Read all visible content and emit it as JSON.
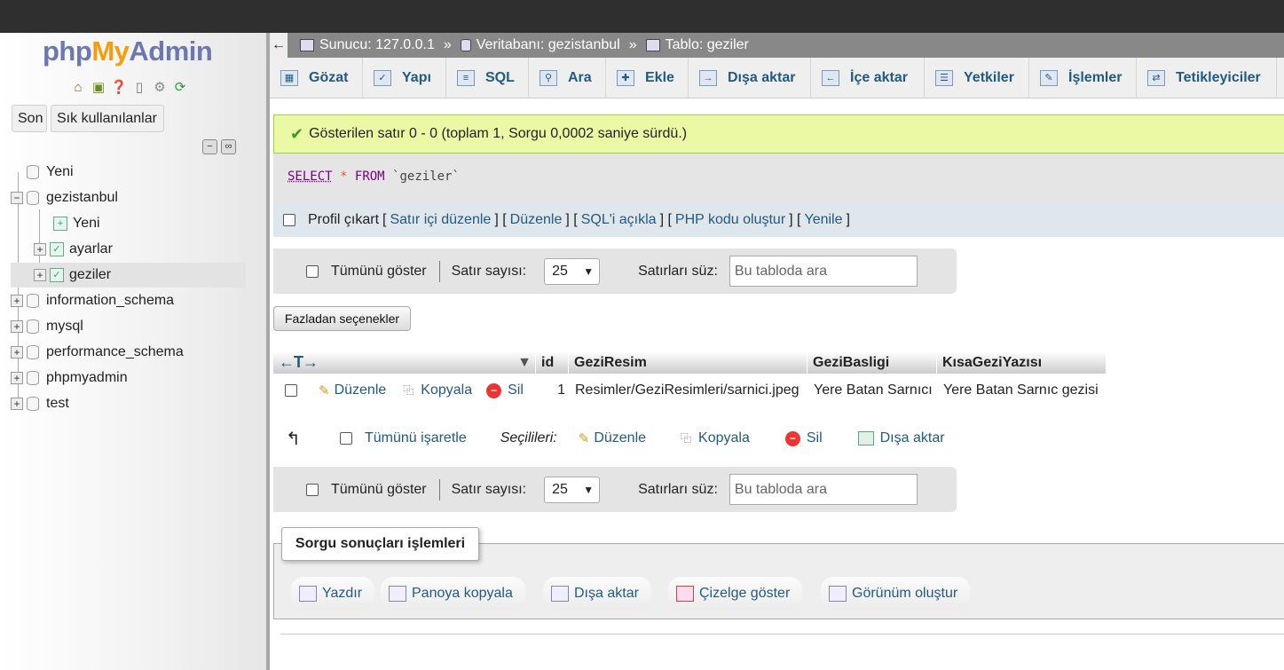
{
  "logo": {
    "php": "php",
    "my": "My",
    "admin": "Admin"
  },
  "sidebar": {
    "recent_button": "Son",
    "favorites_button": "Sık kullanılanlar",
    "tree": [
      {
        "label": "Yeni",
        "level": 0,
        "kind": "new"
      },
      {
        "label": "gezistanbul",
        "level": 0,
        "kind": "db-open"
      },
      {
        "label": "Yeni",
        "level": 1,
        "kind": "new"
      },
      {
        "label": "ayarlar",
        "level": 1,
        "kind": "table"
      },
      {
        "label": "geziler",
        "level": 1,
        "kind": "table"
      },
      {
        "label": "information_schema",
        "level": 0,
        "kind": "db"
      },
      {
        "label": "mysql",
        "level": 0,
        "kind": "db"
      },
      {
        "label": "performance_schema",
        "level": 0,
        "kind": "db"
      },
      {
        "label": "phpmyadmin",
        "level": 0,
        "kind": "db"
      },
      {
        "label": "test",
        "level": 0,
        "kind": "db"
      }
    ]
  },
  "breadcrumb": {
    "server": "Sunucu: 127.0.0.1",
    "database": "Veritabanı: gezistanbul",
    "table": "Tablo: geziler",
    "separator": "»"
  },
  "tabs": [
    "Gözat",
    "Yapı",
    "SQL",
    "Ara",
    "Ekle",
    "Dışa aktar",
    "İçe aktar",
    "Yetkiler",
    "İşlemler",
    "Tetikleyiciler"
  ],
  "message": {
    "success": "Gösterilen satır 0 - 0 (toplam 1, Sorgu 0,0002 saniye sürdü.)"
  },
  "query": {
    "select": "SELECT",
    "star": "*",
    "from": "FROM",
    "table": "`geziler`"
  },
  "profile": {
    "label": "Profil çıkart",
    "links": [
      "Satır içi düzenle",
      "Düzenle",
      "SQL'i açıkla",
      "PHP kodu oluştur",
      "Yenile"
    ]
  },
  "navigation": {
    "show_all": "Tümünü göster",
    "rows_label": "Satır sayısı:",
    "rows_value": "25",
    "filter_label": "Satırları süz:",
    "filter_placeholder": "Bu tabloda ara"
  },
  "more_options": "Fazladan seçenekler",
  "table": {
    "columns": [
      "id",
      "GeziResim",
      "GeziBasligi",
      "KısaGeziYazısı"
    ],
    "row_actions": {
      "edit": "Düzenle",
      "copy": "Kopyala",
      "delete": "Sil"
    },
    "rows": [
      {
        "id": "1",
        "GeziResim": "Resimler/GeziResimleri/sarnici.jpeg",
        "GeziBasligi": "Yere Batan Sarnıcı",
        "KisaGeziYazisi": "Yere Batan Sarnıc gezisi"
      }
    ]
  },
  "bulk": {
    "check_all": "Tümünü işaretle",
    "selected_label": "Seçilileri:",
    "edit": "Düzenle",
    "copy": "Kopyala",
    "delete": "Sil",
    "export": "Dışa aktar"
  },
  "query_ops": {
    "legend": "Sorgu sonuçları işlemleri",
    "buttons": [
      "Yazdır",
      "Panoya kopyala",
      "Dışa aktar",
      "Çizelge göster",
      "Görünüm oluştur"
    ]
  }
}
